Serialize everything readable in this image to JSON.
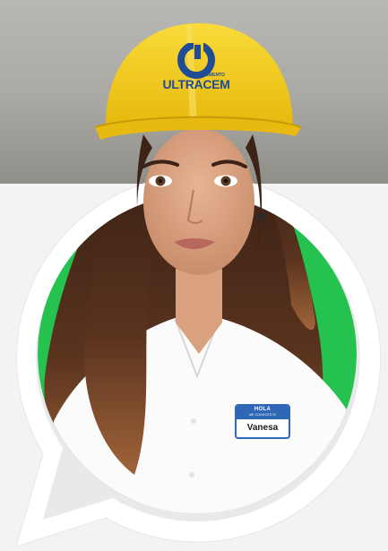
{
  "helmet_logo": {
    "subtitle": "CEMENTO",
    "brand": "ULTRACEM"
  },
  "name_badge": {
    "title": "HOLA",
    "subtitle": "ME CONOCES SI",
    "name": "Vanesa"
  },
  "colors": {
    "helmet_yellow": "#f5cd17",
    "brand_blue": "#1f4c95",
    "whatsapp_green": "#25c24f",
    "bubble_white": "#ffffff",
    "badge_blue": "#2f66b6"
  },
  "icons": [
    "whatsapp-bubble-icon",
    "ultracem-logo-icon"
  ]
}
